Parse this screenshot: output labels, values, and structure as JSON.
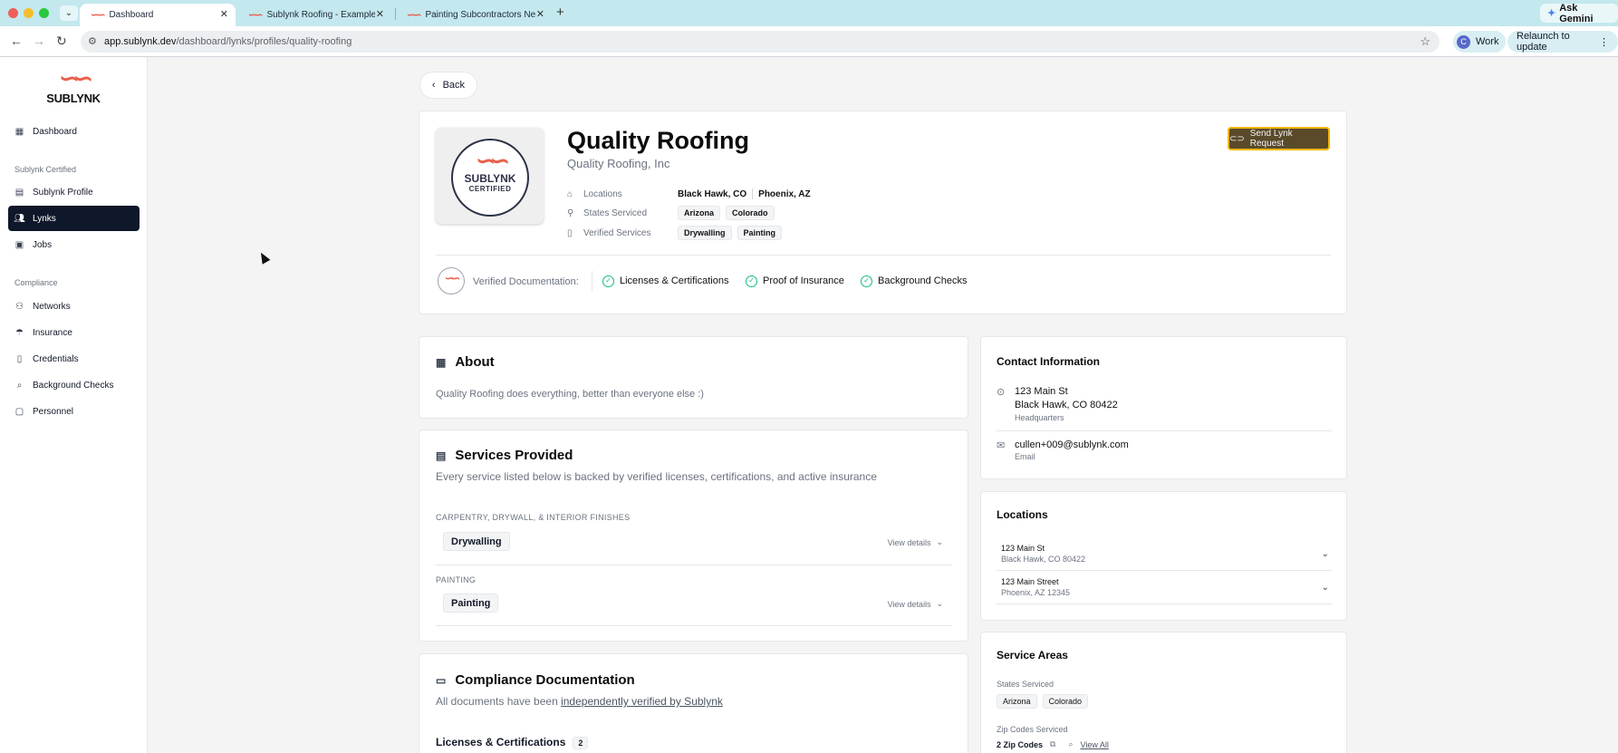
{
  "browser": {
    "tabs": [
      {
        "label": "Dashboard",
        "active": true
      },
      {
        "label": "Sublynk Roofing - Example Co",
        "active": false
      },
      {
        "label": "Painting Subcontractors Neede",
        "active": false
      }
    ],
    "ask_gemini": "Ask Gemini",
    "url_host": "app.sublynk.dev",
    "url_path": "/dashboard/lynks/profiles/quality-roofing",
    "profile_initial": "C",
    "profile_name": "Work",
    "relaunch": "Relaunch to update"
  },
  "sidebar": {
    "logo_text": "SUBLYNK",
    "dashboard": "Dashboard",
    "section_certified": "Sublynk Certified",
    "sublynk_profile": "Sublynk Profile",
    "lynks": "Lynks",
    "jobs": "Jobs",
    "section_compliance": "Compliance",
    "networks": "Networks",
    "insurance": "Insurance",
    "credentials": "Credentials",
    "background_checks": "Background Checks",
    "personnel": "Personnel"
  },
  "header": {
    "back": "Back",
    "badge_line1": "SUBLYNK",
    "badge_line2": "CERTIFIED",
    "company_name": "Quality Roofing",
    "company_legal": "Quality Roofing, Inc",
    "locations_label": "Locations",
    "location_1": "Black Hawk, CO",
    "location_2": "Phoenix, AZ",
    "states_label": "States Serviced",
    "state_1": "Arizona",
    "state_2": "Colorado",
    "services_label": "Verified Services",
    "service_1": "Drywalling",
    "service_2": "Painting",
    "send_request": "Send Lynk Request",
    "verified_docs_label": "Verified Documentation:",
    "check_1": "Licenses & Certifications",
    "check_2": "Proof of Insurance",
    "check_3": "Background Checks"
  },
  "about": {
    "title": "About",
    "text": "Quality Roofing does everything, better than everyone else :)"
  },
  "services": {
    "title": "Services Provided",
    "subtitle": "Every service listed below is backed by verified licenses, certifications, and active insurance",
    "category_1": "CARPENTRY, DRYWALL, & INTERIOR FINISHES",
    "service_1": "Drywalling",
    "category_2": "PAINTING",
    "service_2": "Painting",
    "view_details": "View details"
  },
  "compliance": {
    "title": "Compliance Documentation",
    "subtitle_prefix": "All documents have been ",
    "subtitle_link": "independently verified by Sublynk",
    "licenses_title": "Licenses & Certifications",
    "licenses_count": "2"
  },
  "contact": {
    "title": "Contact Information",
    "address_line1": "123 Main St",
    "address_line2": "Black Hawk, CO 80422",
    "address_type": "Headquarters",
    "email": "cullen+009@sublynk.com",
    "email_label": "Email"
  },
  "locations": {
    "title": "Locations",
    "items": [
      {
        "street": "123 Main St",
        "city": "Black Hawk, CO 80422"
      },
      {
        "street": "123 Main Street",
        "city": "Phoenix, AZ 12345"
      }
    ]
  },
  "service_areas": {
    "title": "Service Areas",
    "states_label": "States Serviced",
    "state_1": "Arizona",
    "state_2": "Colorado",
    "zip_label": "Zip Codes Serviced",
    "zip_count": "2 Zip Codes",
    "view_all": "View All"
  },
  "colors": {
    "brand": "#e8604c",
    "sidebar_active": "#0f172a",
    "send_button": "#5a4a2a",
    "send_button_border": "#f2b807",
    "verified": "#10b981"
  }
}
